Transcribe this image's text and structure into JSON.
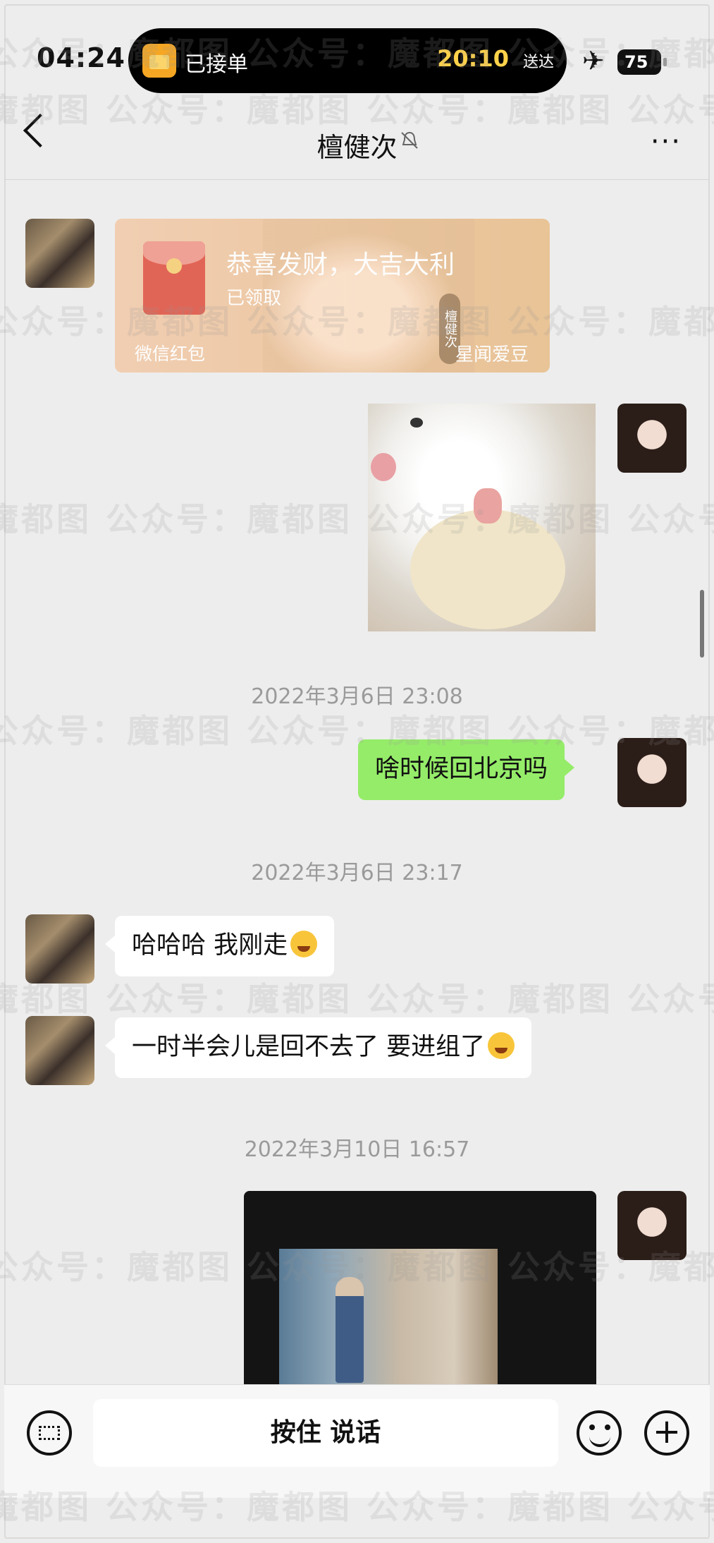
{
  "status_bar": {
    "time": "04:24",
    "island_label": "已接单",
    "island_time": "20:10",
    "island_sub": "送达",
    "battery": "75"
  },
  "header": {
    "title": "檀健次",
    "more": "···"
  },
  "red_packet": {
    "title": "恭喜发财，大吉大利",
    "status": "已领取",
    "footer_left": "微信红包",
    "footer_right": "星闻爱豆",
    "tag": "檀健次"
  },
  "timestamps": {
    "t1": "2022年3月6日 23:08",
    "t2": "2022年3月6日 23:17",
    "t3": "2022年3月10日 16:57"
  },
  "messages": {
    "m1": "啥时候回北京吗",
    "m2": "哈哈哈 我刚走",
    "m3": "一时半会儿是回不去了 要进组了"
  },
  "input_bar": {
    "hold_to_talk": "按住 说话",
    "plus": "+"
  },
  "watermark": {
    "row_a": "魔都图  公众号：魔都图  公众号：魔都图  公众号：魔都图",
    "row_b": "公众号：魔都图  公众号：魔都图  公众号：魔都图  公众号"
  },
  "icons": {
    "plane": "✈"
  }
}
